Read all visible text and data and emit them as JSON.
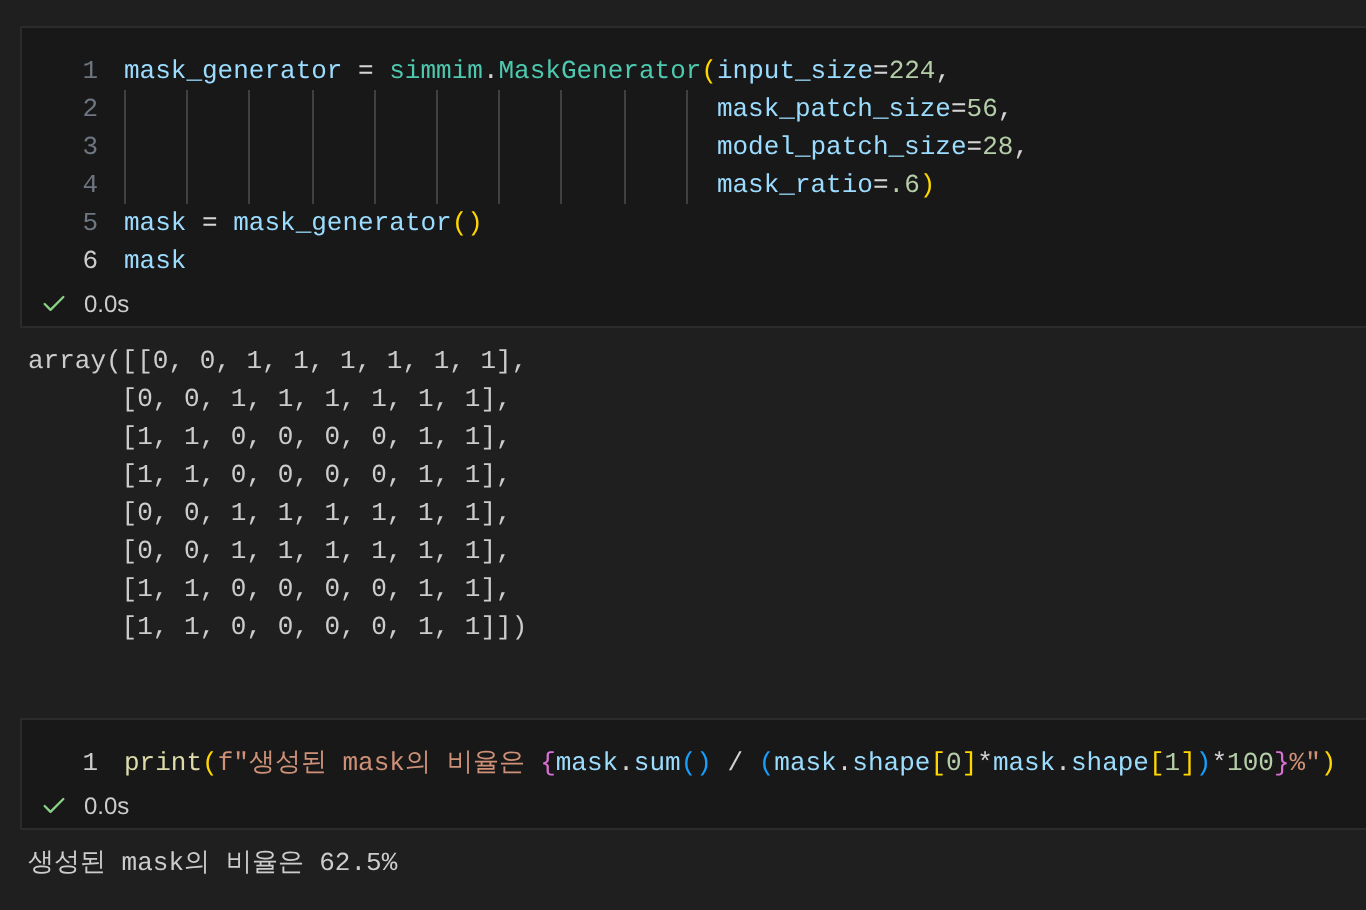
{
  "cells": [
    {
      "lines": [
        {
          "number": "1",
          "active": false,
          "kind": "normal",
          "tokens": [
            {
              "t": "mask_generator",
              "kind": "var"
            },
            {
              "t": " = ",
              "kind": "op"
            },
            {
              "t": "simmim",
              "kind": "type"
            },
            {
              "t": ".",
              "kind": "op"
            },
            {
              "t": "MaskGenerator",
              "kind": "type"
            },
            {
              "t": "(",
              "kind": "paren"
            },
            {
              "t": "input_size",
              "kind": "var"
            },
            {
              "t": "=",
              "kind": "op"
            },
            {
              "t": "224",
              "kind": "num"
            },
            {
              "t": ",",
              "kind": "op"
            }
          ]
        },
        {
          "number": "2",
          "active": false,
          "kind": "continuation",
          "tokens": [
            {
              "t": "mask_patch_size",
              "kind": "var"
            },
            {
              "t": "=",
              "kind": "op"
            },
            {
              "t": "56",
              "kind": "num"
            },
            {
              "t": ",",
              "kind": "op"
            }
          ]
        },
        {
          "number": "3",
          "active": false,
          "kind": "continuation",
          "tokens": [
            {
              "t": "model_patch_size",
              "kind": "var"
            },
            {
              "t": "=",
              "kind": "op"
            },
            {
              "t": "28",
              "kind": "num"
            },
            {
              "t": ",",
              "kind": "op"
            }
          ]
        },
        {
          "number": "4",
          "active": false,
          "kind": "continuation",
          "tokens": [
            {
              "t": "mask_ratio",
              "kind": "var"
            },
            {
              "t": "=",
              "kind": "op"
            },
            {
              "t": ".6",
              "kind": "num"
            },
            {
              "t": ")",
              "kind": "paren"
            }
          ]
        },
        {
          "number": "5",
          "active": false,
          "kind": "normal",
          "tokens": [
            {
              "t": "mask",
              "kind": "var"
            },
            {
              "t": " = ",
              "kind": "op"
            },
            {
              "t": "mask_generator",
              "kind": "var"
            },
            {
              "t": "()",
              "kind": "paren"
            }
          ]
        },
        {
          "number": "6",
          "active": true,
          "kind": "normal",
          "tokens": [
            {
              "t": "mask",
              "kind": "var"
            }
          ]
        }
      ],
      "time": "0.0s",
      "succeeded": true,
      "output": [
        "array([[0, 0, 1, 1, 1, 1, 1, 1],",
        "      [0, 0, 1, 1, 1, 1, 1, 1],",
        "      [1, 1, 0, 0, 0, 0, 1, 1],",
        "      [1, 1, 0, 0, 0, 0, 1, 1],",
        "      [0, 0, 1, 1, 1, 1, 1, 1],",
        "      [0, 0, 1, 1, 1, 1, 1, 1],",
        "      [1, 1, 0, 0, 0, 0, 1, 1],",
        "      [1, 1, 0, 0, 0, 0, 1, 1]])"
      ]
    },
    {
      "lines": [
        {
          "number": "1",
          "active": true,
          "kind": "normal",
          "tokens": [
            {
              "t": "print",
              "kind": "func"
            },
            {
              "t": "(",
              "kind": "paren"
            },
            {
              "t": "f\"생성된 ",
              "kind": "str"
            },
            {
              "t": "mask",
              "kind": "str"
            },
            {
              "t": "의 비율은 ",
              "kind": "str"
            },
            {
              "t": "{",
              "kind": "brace"
            },
            {
              "t": "mask",
              "kind": "var"
            },
            {
              "t": ".",
              "kind": "op"
            },
            {
              "t": "sum",
              "kind": "var"
            },
            {
              "t": "()",
              "kind": "paren2"
            },
            {
              "t": " / ",
              "kind": "op"
            },
            {
              "t": "(",
              "kind": "paren2"
            },
            {
              "t": "mask",
              "kind": "var"
            },
            {
              "t": ".",
              "kind": "op"
            },
            {
              "t": "shape",
              "kind": "var"
            },
            {
              "t": "[",
              "kind": "paren"
            },
            {
              "t": "0",
              "kind": "num"
            },
            {
              "t": "]",
              "kind": "paren"
            },
            {
              "t": "*",
              "kind": "op"
            },
            {
              "t": "mask",
              "kind": "var"
            },
            {
              "t": ".",
              "kind": "op"
            },
            {
              "t": "shape",
              "kind": "var"
            },
            {
              "t": "[",
              "kind": "paren"
            },
            {
              "t": "1",
              "kind": "num"
            },
            {
              "t": "]",
              "kind": "paren"
            },
            {
              "t": ")",
              "kind": "paren2"
            },
            {
              "t": "*",
              "kind": "op"
            },
            {
              "t": "100",
              "kind": "num"
            },
            {
              "t": "}",
              "kind": "brace"
            },
            {
              "t": "%\"",
              "kind": "str"
            },
            {
              "t": ")",
              "kind": "paren"
            }
          ]
        }
      ],
      "time": "0.0s",
      "succeeded": true,
      "output": [
        "생성된 mask의 비율은 62.5%"
      ]
    }
  ]
}
